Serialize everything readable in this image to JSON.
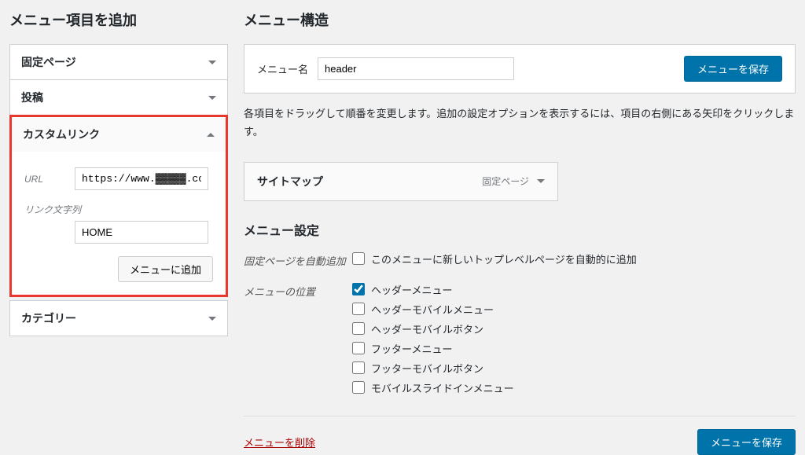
{
  "left": {
    "heading": "メニュー項目を追加",
    "sections": {
      "pages": "固定ページ",
      "posts": "投稿",
      "custom": "カスタムリンク",
      "categories": "カテゴリー"
    },
    "custom": {
      "url_label": "URL",
      "url_value": "https://www.▓▓▓▓▓.co",
      "link_text_label": "リンク文字列",
      "link_text_value": "HOME",
      "add_button": "メニューに追加"
    }
  },
  "right": {
    "heading": "メニュー構造",
    "menu_name_label": "メニュー名",
    "menu_name_value": "header",
    "save_button": "メニューを保存",
    "instruction": "各項目をドラッグして順番を変更します。追加の設定オプションを表示するには、項目の右側にある矢印をクリックします。",
    "menu_item": {
      "title": "サイトマップ",
      "type": "固定ページ"
    },
    "settings_heading": "メニュー設定",
    "auto_add_label": "固定ページを自動追加",
    "auto_add_text": "このメニューに新しいトップレベルページを自動的に追加",
    "location_label": "メニューの位置",
    "locations": [
      {
        "label": "ヘッダーメニュー",
        "checked": true
      },
      {
        "label": "ヘッダーモバイルメニュー",
        "checked": false
      },
      {
        "label": "ヘッダーモバイルボタン",
        "checked": false
      },
      {
        "label": "フッターメニュー",
        "checked": false
      },
      {
        "label": "フッターモバイルボタン",
        "checked": false
      },
      {
        "label": "モバイルスライドインメニュー",
        "checked": false
      }
    ],
    "delete_link": "メニューを削除"
  }
}
